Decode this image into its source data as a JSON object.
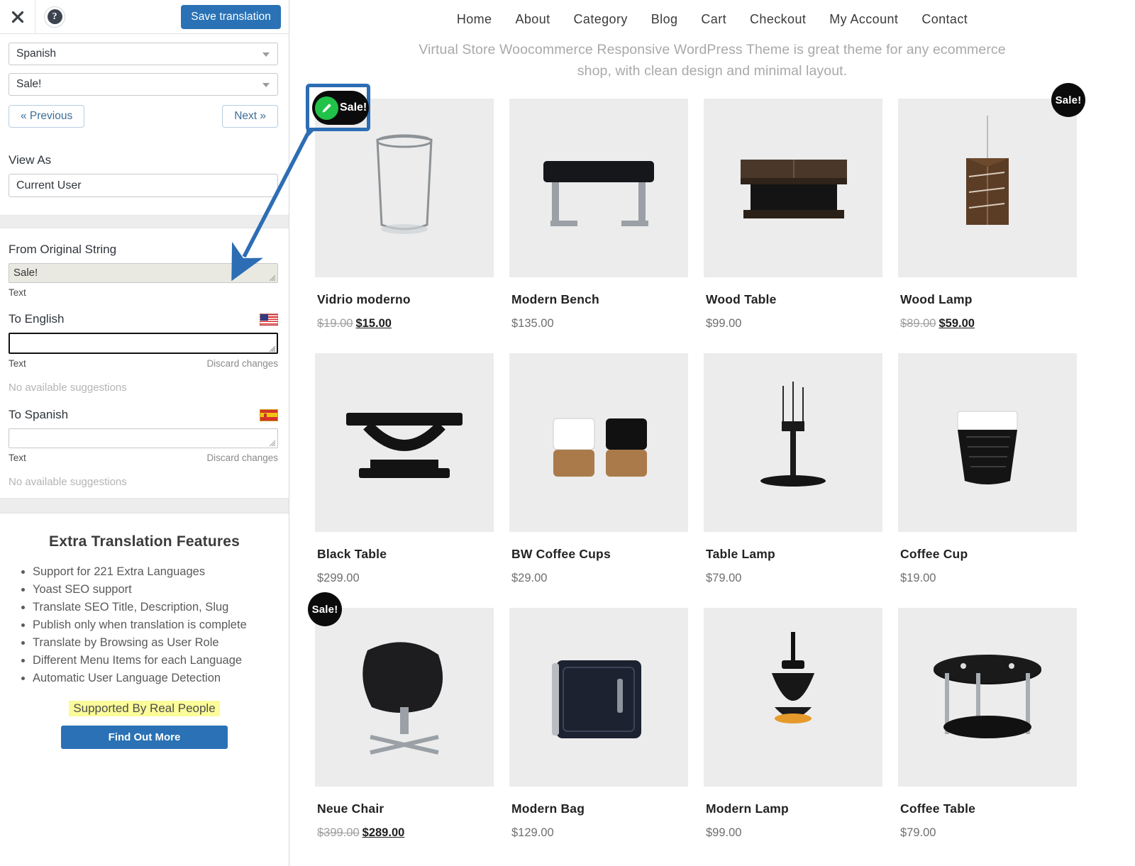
{
  "sidebar": {
    "topbar": {
      "close_icon": "close-icon",
      "help_icon": "question-mark-icon",
      "save_label": "Save translation"
    },
    "language_select": {
      "value": "Spanish"
    },
    "string_select": {
      "value": "Sale!"
    },
    "pagination": {
      "previous": "« Previous",
      "next": "Next »"
    },
    "view_as": {
      "label": "View As",
      "value": "Current User"
    },
    "original": {
      "label": "From Original String",
      "value": "Sale!",
      "meta": "Text"
    },
    "english": {
      "label": "To English",
      "flag": "us-flag-icon",
      "value": "",
      "meta": "Text",
      "discard": "Discard changes",
      "suggestions": "No available suggestions"
    },
    "spanish": {
      "label": "To Spanish",
      "flag": "es-flag-icon",
      "value": "",
      "meta": "Text",
      "discard": "Discard changes",
      "suggestions": "No available suggestions"
    },
    "promo": {
      "title": "Extra Translation Features",
      "items": [
        "Support for 221 Extra Languages",
        "Yoast SEO support",
        "Translate SEO Title, Description, Slug",
        "Publish only when translation is complete",
        "Translate by Browsing as User Role",
        "Different Menu Items for each Language",
        "Automatic User Language Detection"
      ],
      "supported": "Supported By Real People",
      "button": "Find Out More"
    },
    "colors": {
      "accent": "#2a72b5",
      "highlight": "#fbfb9a"
    }
  },
  "store": {
    "nav": [
      "Home",
      "About",
      "Category",
      "Blog",
      "Cart",
      "Checkout",
      "My Account",
      "Contact"
    ],
    "tagline": "Virtual Store Woocommerce Responsive WordPress Theme is great theme for any ecommerce shop, with clean design and minimal layout.",
    "sale_badge_label": "Sale!",
    "products": [
      {
        "title": "Vidrio moderno",
        "old_price": "$19.00",
        "price": "$15.00",
        "on_sale": true,
        "image": "drinking-glass"
      },
      {
        "title": "Modern Bench",
        "old_price": "",
        "price": "$135.00",
        "on_sale": false,
        "image": "bench"
      },
      {
        "title": "Wood Table",
        "old_price": "",
        "price": "$99.00",
        "on_sale": false,
        "image": "wood-table"
      },
      {
        "title": "Wood Lamp",
        "old_price": "$89.00",
        "price": "$59.00",
        "on_sale": true,
        "image": "wood-lamp"
      },
      {
        "title": "Black Table",
        "old_price": "",
        "price": "$299.00",
        "on_sale": false,
        "image": "black-table"
      },
      {
        "title": "BW Coffee Cups",
        "old_price": "",
        "price": "$29.00",
        "on_sale": false,
        "image": "coffee-cups"
      },
      {
        "title": "Table Lamp",
        "old_price": "",
        "price": "$79.00",
        "on_sale": false,
        "image": "table-lamp"
      },
      {
        "title": "Coffee Cup",
        "old_price": "",
        "price": "$19.00",
        "on_sale": false,
        "image": "coffee-cup"
      },
      {
        "title": "Neue Chair",
        "old_price": "$399.00",
        "price": "$289.00",
        "on_sale": true,
        "image": "chair"
      },
      {
        "title": "Modern Bag",
        "old_price": "",
        "price": "$129.00",
        "on_sale": false,
        "image": "bag"
      },
      {
        "title": "Modern Lamp",
        "old_price": "",
        "price": "$99.00",
        "on_sale": false,
        "image": "modern-lamp"
      },
      {
        "title": "Coffee Table",
        "old_price": "",
        "price": "$79.00",
        "on_sale": false,
        "image": "coffee-table"
      }
    ]
  },
  "callout": {
    "badge_label": "Sale!",
    "edit_icon": "pencil-icon",
    "border_color": "#2d6db4"
  }
}
